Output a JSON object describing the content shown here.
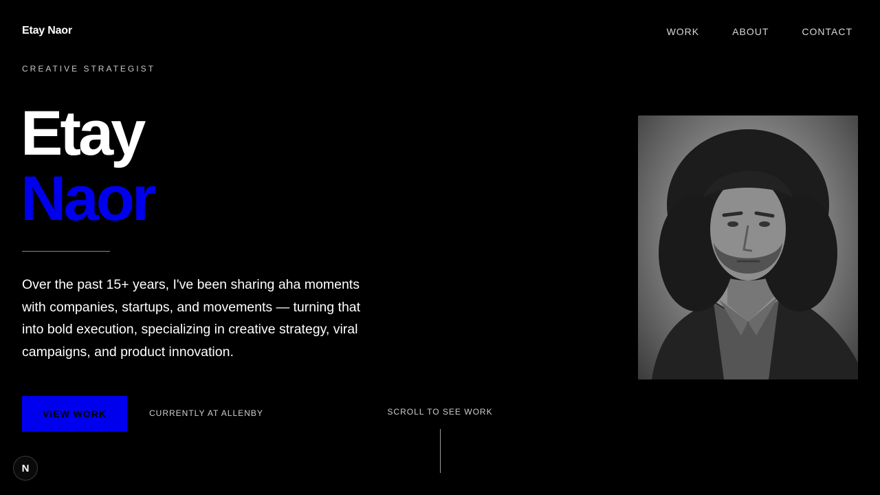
{
  "header": {
    "brand": "Etay Naor",
    "nav": [
      {
        "label": "WORK"
      },
      {
        "label": "ABOUT"
      },
      {
        "label": "CONTACT"
      }
    ]
  },
  "hero": {
    "eyebrow": "CREATIVE STRATEGIST",
    "first_name": "Etay",
    "last_name": "Naor",
    "bio": "Over the past 15+ years, I've been sharing aha moments with companies, startups, and movements — turning that into bold execution, specializing in creative strategy, viral campaigns, and product innovation.",
    "cta_label": "VIEW WORK",
    "current_role": "CURRENTLY AT ALLENBY",
    "scroll_hint": "SCROLL TO SEE WORK"
  },
  "colors": {
    "background": "#000000",
    "accent": "#0000ee",
    "text": "#ffffff"
  },
  "badge": {
    "glyph": "N",
    "icon": "nextjs-badge-icon"
  },
  "portrait": {
    "icon": "portrait-photo"
  }
}
